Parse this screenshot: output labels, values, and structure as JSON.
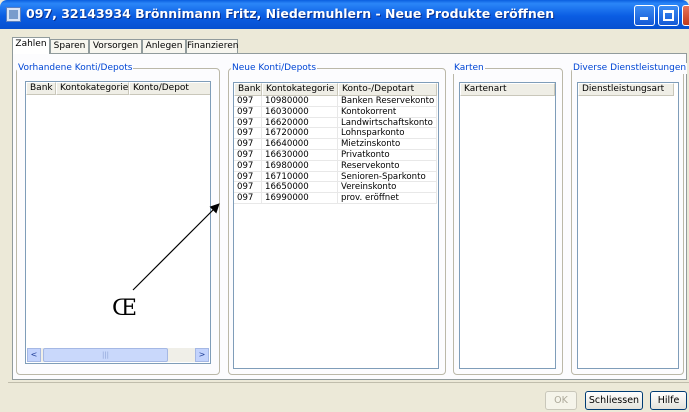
{
  "window": {
    "title": "097, 32143934 Brönnimann Fritz, Niedermuhlern - Neue Produkte eröffnen"
  },
  "tabs": [
    {
      "label": "Zahlen",
      "active": true
    },
    {
      "label": "Sparen",
      "active": false
    },
    {
      "label": "Vorsorgen",
      "active": false
    },
    {
      "label": "Anlegen",
      "active": false
    },
    {
      "label": "Finanzieren",
      "active": false
    }
  ],
  "groups": {
    "existing": {
      "title": "Vorhandene Konti/Depots",
      "columns": [
        "Bank",
        "Kontokategorie",
        "Konto/Depot"
      ]
    },
    "new": {
      "title": "Neue Konti/Depots",
      "columns": [
        "Bank",
        "Kontokategorie",
        "Konto-/Depotart"
      ],
      "rows": [
        [
          "097",
          "10980000",
          "Banken Reservekonto"
        ],
        [
          "097",
          "16030000",
          "Kontokorrent"
        ],
        [
          "097",
          "16620000",
          "Landwirtschaftskonto"
        ],
        [
          "097",
          "16720000",
          "Lohnsparkonto"
        ],
        [
          "097",
          "16640000",
          "Mietzinskonto"
        ],
        [
          "097",
          "16630000",
          "Privatkonto"
        ],
        [
          "097",
          "16980000",
          "Reservekonto"
        ],
        [
          "097",
          "16710000",
          "Senioren-Sparkonto"
        ],
        [
          "097",
          "16650000",
          "Vereinskonto"
        ],
        [
          "097",
          "16990000",
          "prov. eröffnet"
        ]
      ]
    },
    "cards": {
      "title": "Karten",
      "columns": [
        "Kartenart"
      ]
    },
    "services": {
      "title": "Diverse Dienstleistungen",
      "columns": [
        "Dienstleistungsart"
      ]
    }
  },
  "scrollbar": {
    "left_arrow": "<",
    "right_arrow": ">",
    "thumb_grip": "|||"
  },
  "buttons": {
    "ok": "OK",
    "close": "Schliessen",
    "help": "Hilfe"
  },
  "annotation": {
    "glyph": "Œ"
  },
  "icons": {
    "app": "app-window-icon",
    "minimize": "minimize-icon",
    "maximize": "maximize-icon",
    "close": "close-icon"
  },
  "colors": {
    "titlebar": "#0a5de3",
    "legend_text": "#0046d5",
    "window_bg": "#ece9d8"
  }
}
